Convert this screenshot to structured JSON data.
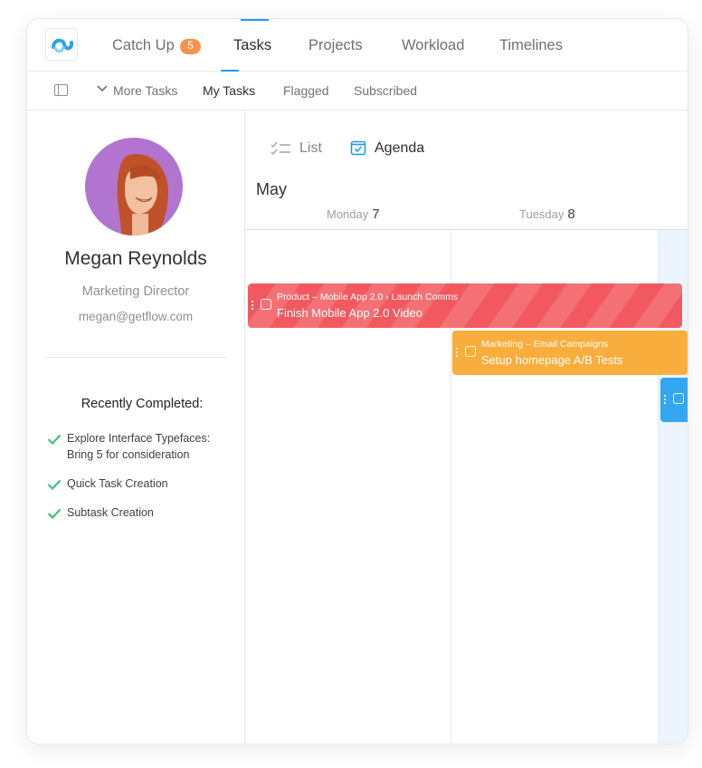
{
  "nav": {
    "tabs": [
      {
        "label": "Catch Up",
        "badge": "5"
      },
      {
        "label": "Tasks",
        "active": true
      },
      {
        "label": "Projects"
      },
      {
        "label": "Workload"
      },
      {
        "label": "Timelines"
      }
    ]
  },
  "subnav": {
    "items": [
      {
        "label": "More Tasks"
      },
      {
        "label": "My Tasks",
        "active": true
      },
      {
        "label": "Flagged"
      },
      {
        "label": "Subscribed"
      }
    ]
  },
  "profile": {
    "name": "Megan Reynolds",
    "role": "Marketing Director",
    "email": "megan@getflow.com",
    "recent_title": "Recently Completed:",
    "recent": [
      {
        "line1": "Explore Interface Typefaces:",
        "line2": "Bring 5 for consideration"
      },
      {
        "line1": "Quick Task Creation"
      },
      {
        "line1": "Subtask Creation"
      }
    ]
  },
  "agenda": {
    "views": [
      {
        "label": "List",
        "icon": "list-icon"
      },
      {
        "label": "Agenda",
        "icon": "calendar-check-icon",
        "active": true
      }
    ],
    "month": "May",
    "days": [
      {
        "name": "Monday",
        "num": "7"
      },
      {
        "name": "Tuesday",
        "num": "8"
      }
    ],
    "events": [
      {
        "sub": "Product – Mobile App 2.0 › Launch Comms",
        "title": "Finish Mobile App 2.0 Video",
        "color": "#f2595f"
      },
      {
        "sub": "Marketing – Email Campaigns",
        "title": "Setup homepage A/B Tests",
        "color": "#f9ad3c"
      },
      {
        "sub": "",
        "title": "",
        "color": "#35a7f0"
      }
    ]
  },
  "colors": {
    "accent": "#1f9af0",
    "badge": "#f5944b",
    "check": "#3cc37a"
  }
}
